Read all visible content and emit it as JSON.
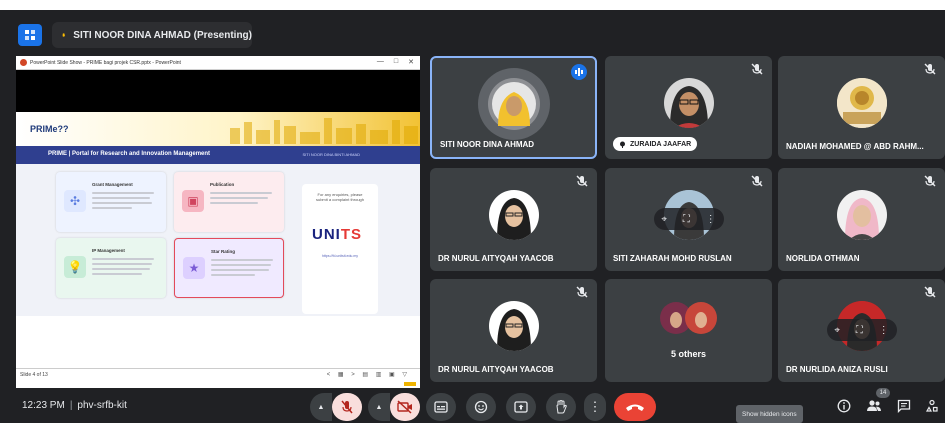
{
  "presenting": {
    "text": "SITI NOOR DINA AHMAD (Presenting)"
  },
  "powerpoint": {
    "window_title": "PowerPoint Slide Show  -  PRIME bagi projek CSR.pptx  -  PowerPoint",
    "controls": [
      "—",
      "□",
      "✕"
    ],
    "slide": {
      "logo": "PRIMe??",
      "nav_title": "PRIME | Portal for Research and Innovation Management",
      "nav_right": "SITI NOOR DINA BINTI AHMAD",
      "cards": [
        {
          "title": "Grant Management",
          "icon": "grant-icon"
        },
        {
          "title": "Publication",
          "icon": "publication-icon"
        },
        {
          "title": "IP Management",
          "icon": "ip-icon"
        },
        {
          "title": "Star Rating",
          "icon": "star-icon"
        }
      ],
      "side_text": "For any enquiries, please submit a complaint through",
      "side_logo_main": "UNI",
      "side_logo_accent": "TS",
      "side_link": "https://fd.unitsit.edu.my",
      "logo_strip": "▬ ■ ▬ ■ ▬ ■ ▬"
    },
    "status_left": "Slide 4 of 13",
    "status_controls": "< ▦ > ▤ ▥ ▣ ▽"
  },
  "participants": [
    {
      "name": "SITI NOOR DINA AHMAD",
      "state": "speaking"
    },
    {
      "name": "ZURAIDA JAAFAR",
      "state": "muted"
    },
    {
      "name": "NADIAH MOHAMED @ ABD RAHM...",
      "state": "muted"
    },
    {
      "name": "DR NURUL AITYQAH YAACOB",
      "state": "muted"
    },
    {
      "name": "SITI ZAHARAH MOHD RUSLAN",
      "state": "muted"
    },
    {
      "name": "NORLIDA OTHMAN",
      "state": "muted"
    },
    {
      "name": "DR NURUL AITYQAH YAACOB",
      "state": "muted"
    },
    {
      "name": "5 others",
      "state": "group"
    },
    {
      "name": "DR NURLIDA ANIZA RUSLI",
      "state": "muted"
    }
  ],
  "bottom_bar": {
    "time": "12:23 PM",
    "meeting_code": "phv-srfb-kit",
    "tooltip": "Show hidden icons",
    "people_count": "14"
  },
  "colors": {
    "background": "#202124",
    "tile": "#3c4043",
    "accent": "#1a73e8",
    "end_call": "#ea4335",
    "muted_soft": "#f9dedc"
  }
}
